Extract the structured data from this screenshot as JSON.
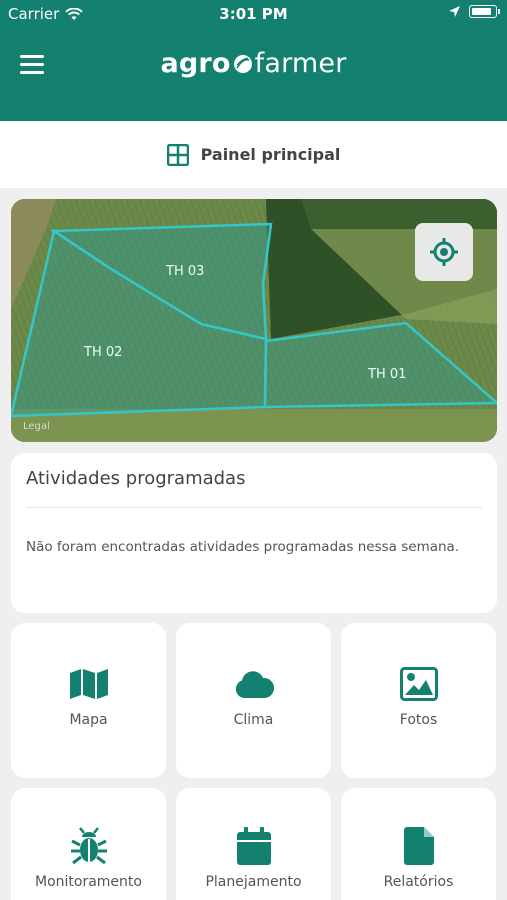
{
  "status_bar": {
    "carrier": "Carrier",
    "time": "3:01 PM",
    "battery_level": 0.85
  },
  "header": {
    "logo_prefix": "agro",
    "logo_suffix": "farmer",
    "menu_icon": "hamburger-menu-icon"
  },
  "panel": {
    "title": "Painel principal",
    "icon": "grid-icon"
  },
  "map": {
    "legal_label": "Legal",
    "fields": [
      "TH 03",
      "TH 02",
      "TH 01"
    ],
    "locate_icon": "crosshair-icon"
  },
  "activities": {
    "title": "Atividades programadas",
    "empty_message": "Não foram encontradas atividades programadas nessa semana."
  },
  "menu_tiles": [
    {
      "label": "Mapa",
      "icon": "map-icon"
    },
    {
      "label": "Clima",
      "icon": "cloud-icon"
    },
    {
      "label": "Fotos",
      "icon": "image-icon"
    },
    {
      "label": "Monitoramento",
      "icon": "bug-icon"
    },
    {
      "label": "Planejamento",
      "icon": "calendar-icon"
    },
    {
      "label": "Relatórios",
      "icon": "document-icon"
    }
  ],
  "colors": {
    "brand": "#14806f",
    "field_outline": "#35c6c8",
    "background": "#efefef"
  }
}
